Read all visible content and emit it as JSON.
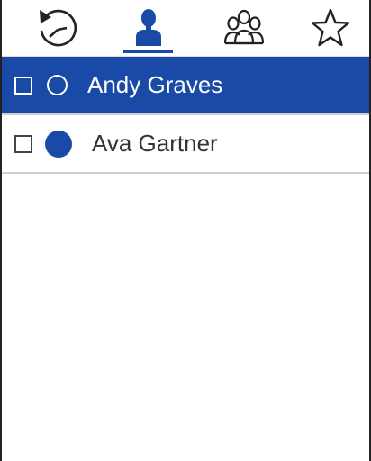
{
  "tabs": [
    {
      "icon": "history-icon",
      "active": false
    },
    {
      "icon": "contact-icon",
      "active": true
    },
    {
      "icon": "groups-icon",
      "active": false
    },
    {
      "icon": "favorites-icon",
      "active": false
    }
  ],
  "colors": {
    "accent": "#1a4aa8",
    "selected_row_bg": "#1a4aa8",
    "divider": "#cfcfcf"
  },
  "contacts": [
    {
      "name": "Andy Graves",
      "status": "offline",
      "selected": true,
      "checked": false
    },
    {
      "name": "Ava Gartner",
      "status": "online",
      "selected": false,
      "checked": false
    }
  ]
}
